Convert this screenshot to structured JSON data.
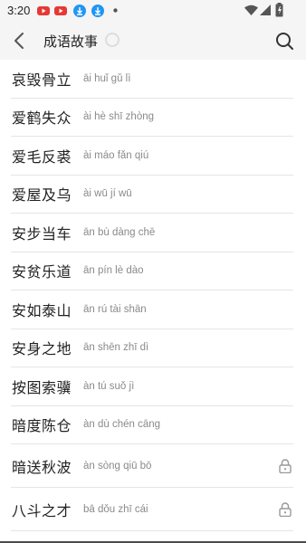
{
  "status": {
    "time": "3:20",
    "icons": [
      "youtube-icon",
      "youtube-icon",
      "download-icon",
      "download-icon",
      "dot-icon",
      "wifi-icon",
      "signal-icon",
      "battery-icon"
    ],
    "red": "#e53935",
    "blue": "#2196f3"
  },
  "header": {
    "title": "成语故事",
    "back_icon": "back-chevron-icon",
    "search_icon": "search-icon"
  },
  "list": [
    {
      "idiom": "哀毁骨立",
      "pinyin": "āi huǐ gǔ lì",
      "locked": false
    },
    {
      "idiom": "爱鹤失众",
      "pinyin": "ài hè shī zhòng",
      "locked": false
    },
    {
      "idiom": "爱毛反裘",
      "pinyin": "ài máo fǎn qiú",
      "locked": false
    },
    {
      "idiom": "爱屋及乌",
      "pinyin": "ài wū jí wū",
      "locked": false
    },
    {
      "idiom": "安步当车",
      "pinyin": "ān bù dàng chē",
      "locked": false
    },
    {
      "idiom": "安贫乐道",
      "pinyin": "ān pín lè dào",
      "locked": false
    },
    {
      "idiom": "安如泰山",
      "pinyin": "ān rú tài shān",
      "locked": false
    },
    {
      "idiom": "安身之地",
      "pinyin": "ān shēn zhī dì",
      "locked": false
    },
    {
      "idiom": "按图索骥",
      "pinyin": "àn tú suǒ jì",
      "locked": false
    },
    {
      "idiom": "暗度陈仓",
      "pinyin": "àn dù chén cāng",
      "locked": false
    },
    {
      "idiom": "暗送秋波",
      "pinyin": "àn sòng qiū bō",
      "locked": true
    },
    {
      "idiom": "八斗之才",
      "pinyin": "bā dǒu zhī cái",
      "locked": true
    }
  ]
}
